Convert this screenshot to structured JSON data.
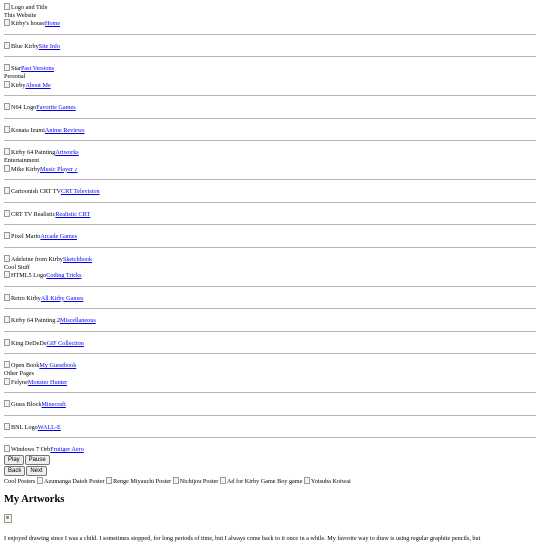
{
  "header": {
    "logo_alt": "Logo and Title",
    "site_heading": "This Website"
  },
  "nav": {
    "website": [
      {
        "img_alt": "Kirby's house",
        "link": "Home"
      },
      {
        "img_alt": "Blue Kirby",
        "link": "Site Info"
      },
      {
        "img_alt": "Star",
        "link": "Past Versions"
      }
    ],
    "personal_heading": "Personal",
    "personal": [
      {
        "img_alt": "Kirby",
        "link": "About Me"
      },
      {
        "img_alt": "N64 Logo",
        "link": "Favorite Games"
      },
      {
        "img_alt": "Konata Izumi",
        "link": "Anime Reviews"
      },
      {
        "img_alt": "Kirby 64 Painting",
        "link": "Artworks"
      }
    ],
    "entertainment_heading": "Entertainment",
    "entertainment": [
      {
        "img_alt": "Mike Kirby",
        "link": "Music Player ♪"
      },
      {
        "img_alt": "Cartoonish CRT TV",
        "link": "CRT Television"
      },
      {
        "img_alt": "CRT TV Realistic",
        "link": "Realistic CRT"
      },
      {
        "img_alt": "Pixel Mario",
        "link": "Arcade Games"
      },
      {
        "img_alt": "Adeleine from Kirby",
        "link": "Sketchbook"
      }
    ],
    "cool_heading": "Cool Stuff",
    "cool": [
      {
        "img_alt": "HTML5 Logo",
        "link": "Coding Tricks"
      },
      {
        "img_alt": "Retro Kirby",
        "link": "All Kirby Games"
      },
      {
        "img_alt": "Kirby 64 Painting 2",
        "link": "Miscellaneous"
      },
      {
        "img_alt": "King DeDeDe",
        "link": "GIF Collection"
      },
      {
        "img_alt": "Open Book",
        "link": "My Guestbook"
      }
    ],
    "other_heading": "Other Pages",
    "other": [
      {
        "img_alt": "Felyne",
        "link": "Monster Hunter"
      },
      {
        "img_alt": "Grass Block",
        "link": "Minecraft"
      },
      {
        "img_alt": "BNL Logo",
        "link": "WALL-E"
      },
      {
        "img_alt": "Windows 7 Orb",
        "link": "Frutiger Aero"
      }
    ]
  },
  "player": {
    "play": "Play",
    "pause": "Pause",
    "back": "Back",
    "next": "Next"
  },
  "posters": {
    "label": "Cool Posters",
    "items": [
      "Azumanga Daioh Poster",
      "Renge Miyauchi Poster",
      "Nichijou Poster",
      "Ad for Kirby Game Boy game",
      "Yotsuba Koiwai"
    ]
  },
  "main": {
    "title": "My Artworks",
    "intro": "I enjoyed drawing since I was a child. I sometimes stopped, for long periods of time, but I always come back to it once in a while. My favorite way to draw is using regular graphite pencils, but"
  }
}
